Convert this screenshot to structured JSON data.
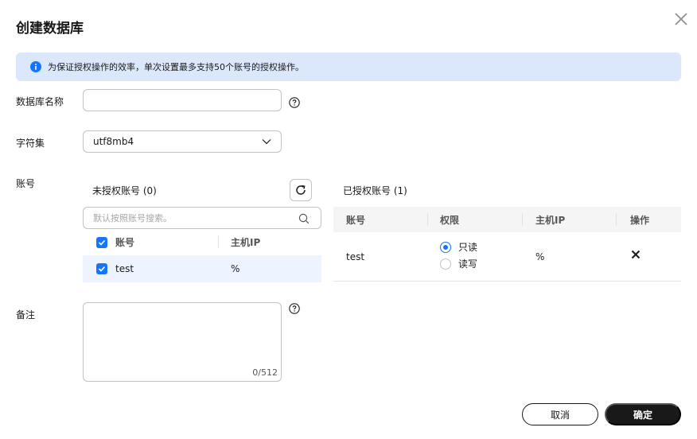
{
  "dialog": {
    "title": "创建数据库"
  },
  "notice": {
    "text": "为保证授权操作的效率，单次设置最多支持50个账号的授权操作。"
  },
  "form": {
    "db_name_label": "数据库名称",
    "db_name_value": "",
    "charset_label": "字符集",
    "charset_value": "utf8mb4",
    "account_label": "账号",
    "remark_label": "备注",
    "remark_value": "",
    "remark_counter": "0/512"
  },
  "unauthorized": {
    "title": "未授权账号 (0)",
    "search_placeholder": "默认按照账号搜索。",
    "columns": [
      "账号",
      "主机IP"
    ],
    "rows": [
      {
        "account": "test",
        "host": "%",
        "checked": true
      }
    ]
  },
  "authorized": {
    "title": "已授权账号 (1)",
    "columns": [
      "账号",
      "权限",
      "主机IP",
      "操作"
    ],
    "rows": [
      {
        "account": "test",
        "perm_options": [
          "只读",
          "读写"
        ],
        "selected": "只读",
        "host": "%"
      }
    ]
  },
  "buttons": {
    "cancel": "取消",
    "confirm": "确定"
  },
  "colors": {
    "accent": "#1476ff",
    "notice_bg": "#dbe8fb",
    "primary_btn": "#191919"
  }
}
